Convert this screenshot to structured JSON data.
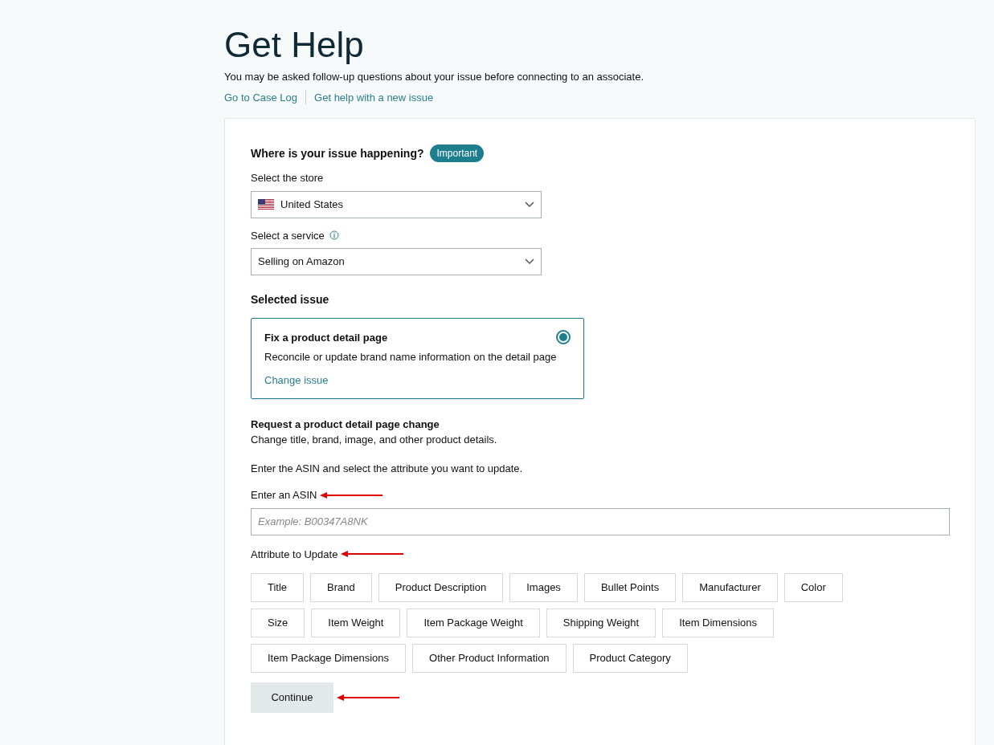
{
  "page": {
    "title": "Get Help",
    "subtitle": "You may be asked follow-up questions about your issue before connecting to an associate.",
    "links": [
      "Go to Case Log",
      "Get help with a new issue"
    ]
  },
  "location": {
    "heading": "Where is your issue happening?",
    "badge": "Important",
    "store_label": "Select the store",
    "store_value": "United States",
    "service_label": "Select a service",
    "service_value": "Selling on Amazon"
  },
  "issue": {
    "heading": "Selected issue",
    "title": "Fix a product detail page",
    "description": "Reconcile or update brand name information on the detail page",
    "link": "Change issue",
    "selected": true
  },
  "request": {
    "heading": "Request a product detail page change",
    "description": "Change title, brand, image, and other product details.",
    "instruction": "Enter the ASIN and select the attribute you want to update.",
    "asin_label": "Enter an ASIN",
    "asin_placeholder": "Example: B00347A8NK",
    "attribute_label": "Attribute to Update",
    "attributes": [
      [
        "Title",
        "Brand",
        "Product Description",
        "Images",
        "Bullet Points",
        "Manufacturer",
        "Color"
      ],
      [
        "Size",
        "Item Weight",
        "Item Package Weight",
        "Shipping Weight",
        "Item Dimensions"
      ],
      [
        "Item Package Dimensions",
        "Other Product Information",
        "Product Category"
      ]
    ],
    "continue": "Continue"
  }
}
